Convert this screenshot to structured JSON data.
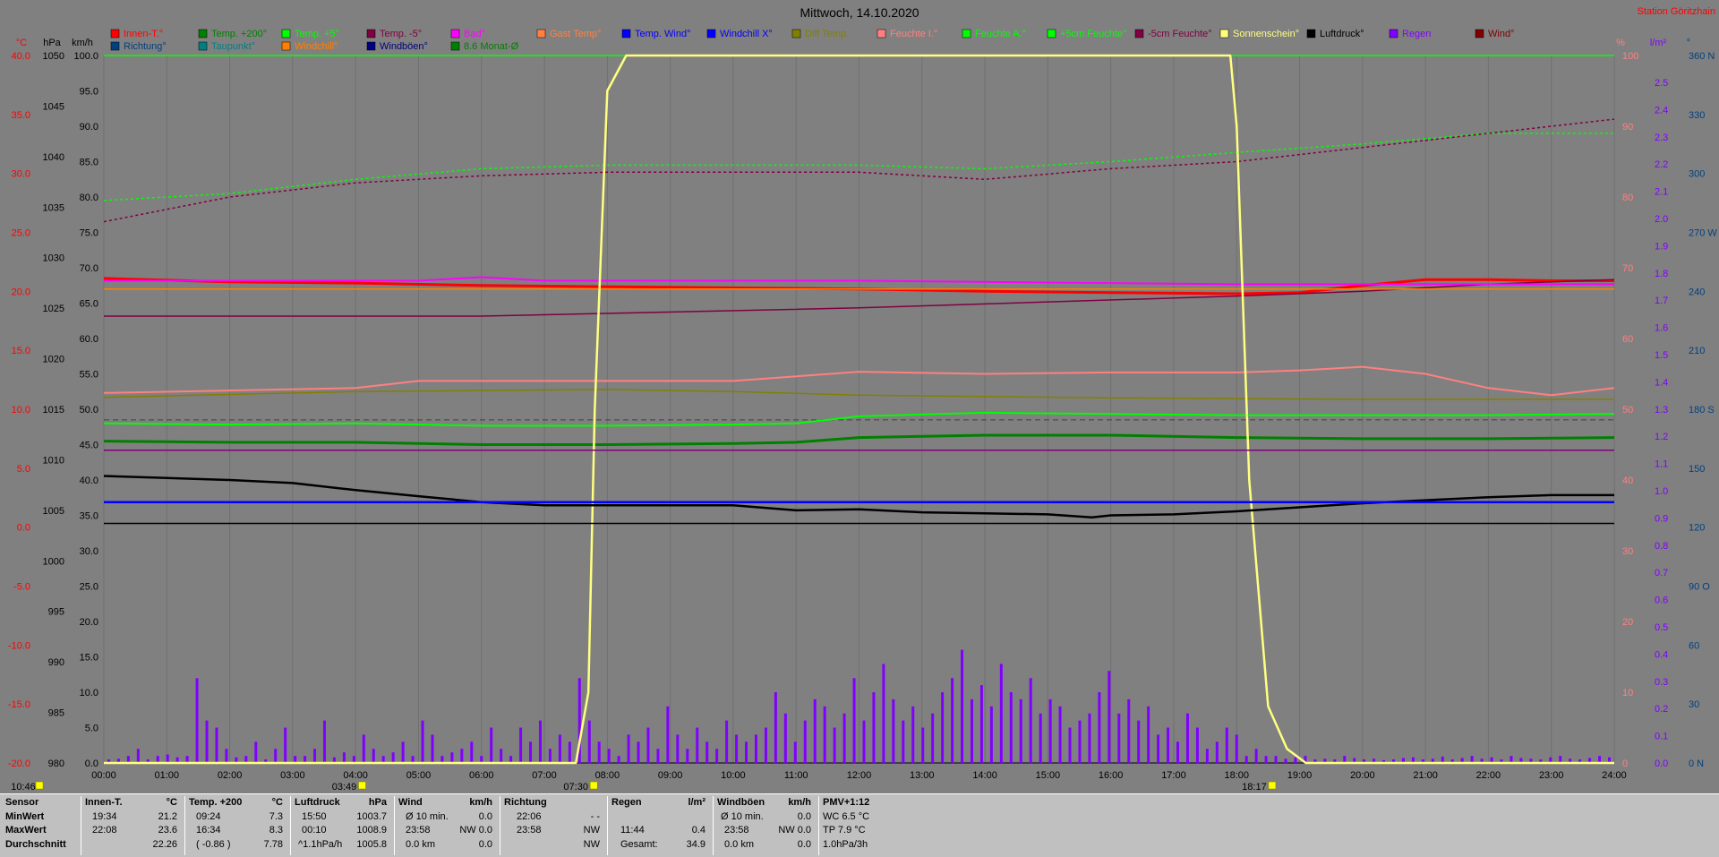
{
  "title": "Mittwoch, 14.10.2020",
  "station": "Station Göritzhain",
  "axes": {
    "tempUnit": "°C",
    "tempTicks": [
      "40.0",
      "35.0",
      "30.0",
      "25.0",
      "20.0",
      "15.0",
      "10.0",
      "5.0",
      "0.0",
      "-5.0",
      "-10.0",
      "-15.0",
      "-20.0"
    ],
    "hpaUnit": "hPa",
    "hpaTicks": [
      "1050",
      "1045",
      "1040",
      "1035",
      "1030",
      "1025",
      "1020",
      "1015",
      "1010",
      "1005",
      "1000",
      "995",
      "990",
      "985",
      "980"
    ],
    "kmhUnit": "km/h",
    "kmhTicks": [
      "100.0",
      "95.0",
      "90.0",
      "85.0",
      "80.0",
      "75.0",
      "70.0",
      "65.0",
      "60.0",
      "55.0",
      "50.0",
      "45.0",
      "40.0",
      "35.0",
      "30.0",
      "25.0",
      "20.0",
      "15.0",
      "10.0",
      "5.0",
      "0.0"
    ],
    "pctUnit": "%",
    "pctTicks": [
      "100",
      "90",
      "80",
      "70",
      "60",
      "50",
      "40",
      "30",
      "20",
      "10",
      "0"
    ],
    "rainUnit": "l/m²",
    "rainTicks": [
      "2.5",
      "2.4",
      "2.3",
      "2.2",
      "2.1",
      "2.0",
      "1.9",
      "1.8",
      "1.7",
      "1.6",
      "1.5",
      "1.4",
      "1.3",
      "1.2",
      "1.1",
      "1.0",
      "0.9",
      "0.8",
      "0.7",
      "0.6",
      "0.5",
      "0.4",
      "0.3",
      "0.2",
      "0.1",
      "0.0"
    ],
    "dirUnit": "°",
    "dirTicks": [
      "360 N",
      "330",
      "300",
      "270 W",
      "240",
      "210",
      "180 S",
      "150",
      "120",
      "90 O",
      "60",
      "30",
      "0 N"
    ],
    "timeTicks": [
      "00:00",
      "01:00",
      "02:00",
      "03:00",
      "04:00",
      "05:00",
      "06:00",
      "07:00",
      "08:00",
      "09:00",
      "10:00",
      "11:00",
      "12:00",
      "13:00",
      "14:00",
      "15:00",
      "16:00",
      "17:00",
      "18:00",
      "19:00",
      "20:00",
      "21:00",
      "22:00",
      "23:00",
      "24:00"
    ],
    "markers": [
      {
        "label": "10:46",
        "hour": 0
      },
      {
        "label": "03:49",
        "hour": 3.82
      },
      {
        "label": "07:30",
        "hour": 7.5
      },
      {
        "label": "18:17",
        "hour": 18.28
      }
    ]
  },
  "legend": {
    "row1": [
      {
        "label": "Innen-T.°",
        "color": "#ff0000"
      },
      {
        "label": "Temp. +200°",
        "color": "#008000"
      },
      {
        "label": "Temp. +5°",
        "color": "#00ff00"
      },
      {
        "label": "Temp. -5°",
        "color": "#800040"
      },
      {
        "label": "Bad°",
        "color": "#ff00ff"
      },
      {
        "label": "Gast Temp°",
        "color": "#ff8040"
      },
      {
        "label": "Temp. Wind°",
        "color": "#0000ff"
      },
      {
        "label": "Windchill X°",
        "color": "#0000ff"
      },
      {
        "label": "Diff Temp.",
        "color": "#808000"
      },
      {
        "label": "Feuchte I.°",
        "color": "#ff8080"
      },
      {
        "label": "Feuchte A.°",
        "color": "#00ff00"
      },
      {
        "label": "+5cm Feuchte°",
        "color": "#00ff00"
      },
      {
        "label": "-5cm Feuchte°",
        "color": "#800040"
      },
      {
        "label": "Sonnenschein°",
        "color": "#ffff80"
      },
      {
        "label": "Luftdruck°",
        "color": "#000000"
      },
      {
        "label": "Regen",
        "color": "#8000ff"
      },
      {
        "label": "Wind°",
        "color": "#800000"
      }
    ],
    "row2": [
      {
        "label": "Richtung°",
        "color": "#004080"
      },
      {
        "label": "Taupunkt°",
        "color": "#008080"
      },
      {
        "label": "Windchill°",
        "color": "#ff8000"
      },
      {
        "label": "Windböen°",
        "color": "#000080"
      },
      {
        "label": "8.6 Monat-Ø",
        "color": "#008000"
      }
    ]
  },
  "chart_data": {
    "type": "line",
    "title": "Mittwoch, 14.10.2020",
    "x_range": [
      0,
      24
    ],
    "series": [
      {
        "name": "Innen-T.°",
        "axis": "temp",
        "color": "#ff0000",
        "width": 3,
        "x": [
          0,
          2,
          4,
          6,
          8,
          10,
          12,
          14,
          16,
          18,
          19,
          20,
          21,
          22,
          23,
          24
        ],
        "y": [
          21.1,
          20.8,
          20.7,
          20.5,
          20.4,
          20.3,
          20.2,
          20.0,
          19.9,
          19.8,
          19.9,
          20.5,
          21.0,
          21.0,
          20.9,
          20.9
        ]
      },
      {
        "name": "Temp. +200°",
        "axis": "temp",
        "color": "#008000",
        "width": 3,
        "x": [
          0,
          2,
          4,
          6,
          8,
          10,
          11,
          12,
          14,
          16,
          18,
          20,
          22,
          24
        ],
        "y": [
          7.3,
          7.2,
          7.2,
          7.0,
          7.0,
          7.1,
          7.2,
          7.6,
          7.8,
          7.8,
          7.6,
          7.5,
          7.5,
          7.6
        ]
      },
      {
        "name": "Temp. +5°",
        "axis": "temp",
        "color": "#00ff00",
        "width": 2,
        "x": [
          0,
          2,
          4,
          6,
          8,
          10,
          11,
          12,
          14,
          16,
          18,
          20,
          22,
          24
        ],
        "y": [
          8.8,
          8.7,
          8.8,
          8.6,
          8.6,
          8.7,
          8.8,
          9.4,
          9.7,
          9.6,
          9.5,
          9.5,
          9.5,
          9.6
        ]
      },
      {
        "name": "Temp. -5°",
        "axis": "temp",
        "color": "#800040",
        "width": 1.5,
        "x": [
          0,
          6,
          12,
          18,
          20,
          22,
          24
        ],
        "y": [
          17.9,
          17.9,
          18.6,
          19.6,
          20.0,
          20.6,
          21.0
        ]
      },
      {
        "name": "Bad°",
        "axis": "temp",
        "color": "#ff00ff",
        "width": 2,
        "x": [
          0,
          5,
          6,
          7,
          12,
          18,
          24
        ],
        "y": [
          20.9,
          20.9,
          21.2,
          20.9,
          20.9,
          20.6,
          20.6
        ]
      },
      {
        "name": "Windchill°",
        "axis": "temp",
        "color": "#ff8000",
        "width": 1.5,
        "x": [
          0,
          24
        ],
        "y": [
          20.2,
          20.2
        ]
      },
      {
        "name": "Feuchte I.°",
        "axis": "pct",
        "color": "#ff8080",
        "width": 2,
        "x": [
          0,
          4,
          5,
          10,
          12,
          14,
          16,
          18,
          19,
          20,
          21,
          22,
          23,
          24
        ],
        "y": [
          52.3,
          53.0,
          54.0,
          54.0,
          55.3,
          55.0,
          55.2,
          55.2,
          55.5,
          56.0,
          55.0,
          53.0,
          52.0,
          53.0
        ]
      },
      {
        "name": "Diff Temp.",
        "axis": "pct",
        "color": "#808000",
        "width": 1.5,
        "x": [
          0,
          4,
          8,
          10,
          12,
          16,
          20,
          24
        ],
        "y": [
          51.7,
          52.5,
          52.8,
          52.5,
          52.0,
          51.6,
          51.4,
          51.4
        ]
      },
      {
        "name": "Feuchte A.°",
        "axis": "pct",
        "color": "#00ff00",
        "width": 1.5,
        "x": [
          0,
          24
        ],
        "y": [
          100,
          100
        ]
      },
      {
        "name": "+5cm Feuchte°",
        "axis": "pct",
        "color": "#00ff00",
        "width": 1.5,
        "dash": "3,3",
        "x": [
          0,
          2,
          4,
          6,
          8,
          10,
          12,
          14,
          16,
          18,
          20,
          22,
          24
        ],
        "y": [
          79.5,
          80.5,
          82.5,
          84.0,
          84.5,
          84.5,
          84.5,
          84.0,
          85.0,
          86.3,
          87.5,
          89.0,
          89.0
        ]
      },
      {
        "name": "-5cm Feuchte°",
        "axis": "pct",
        "color": "#800040",
        "width": 1.5,
        "dash": "3,3",
        "x": [
          0,
          2,
          4,
          6,
          8,
          10,
          12,
          14,
          16,
          18,
          20,
          22,
          24
        ],
        "y": [
          76.5,
          80.0,
          82.0,
          83.0,
          83.5,
          83.5,
          83.5,
          82.5,
          84.0,
          85.0,
          87.0,
          89.0,
          91.0
        ]
      },
      {
        "name": "Sonnenschein°",
        "axis": "pct",
        "color": "#ffff80",
        "width": 2.5,
        "x": [
          0,
          7.5,
          7.7,
          7.8,
          8.0,
          8.3,
          17.9,
          18.0,
          18.2,
          18.5,
          18.8,
          19.1,
          24
        ],
        "y": [
          0,
          0,
          10,
          50,
          95,
          100,
          100,
          90,
          40,
          8,
          2,
          0,
          0
        ]
      },
      {
        "name": "Luftdruck°",
        "axis": "hpa",
        "color": "#000000",
        "width": 2.5,
        "x": [
          0,
          1,
          2,
          3,
          4,
          5,
          6,
          7,
          8,
          9,
          10,
          11,
          12,
          13,
          14,
          15,
          15.7,
          16,
          17,
          18,
          19,
          20,
          21,
          22,
          23,
          24
        ],
        "y": [
          1008.4,
          1008.2,
          1008.0,
          1007.7,
          1007.0,
          1006.4,
          1005.8,
          1005.5,
          1005.5,
          1005.5,
          1005.5,
          1005.0,
          1005.1,
          1004.8,
          1004.7,
          1004.6,
          1004.3,
          1004.5,
          1004.6,
          1004.9,
          1005.3,
          1005.7,
          1006.0,
          1006.3,
          1006.5,
          1006.5
        ]
      },
      {
        "name": "Temp. Wind°",
        "axis": "hpa",
        "color": "#0000ff",
        "width": 2.5,
        "x": [
          0,
          24
        ],
        "y": [
          1005.8,
          1005.8
        ]
      },
      {
        "name": "Windböen°",
        "axis": "hpa",
        "color": "#000000",
        "width": 1.5,
        "x": [
          0,
          24
        ],
        "y": [
          1003.7,
          1003.7
        ]
      },
      {
        "name": "Windchill X°",
        "axis": "pct",
        "color": "#800080",
        "width": 1.5,
        "x": [
          0,
          24
        ],
        "y": [
          44.2,
          44.2
        ]
      }
    ],
    "rain_bars": {
      "axis": "kmh",
      "color": "#8000ff",
      "note": "wind bars (km/h), one per ~10 min",
      "values": [
        0.5,
        0.6,
        1,
        2,
        0.5,
        1,
        1.2,
        0.8,
        1,
        12,
        6,
        5,
        2,
        0.8,
        1,
        3,
        0.5,
        2,
        5,
        1,
        1,
        2,
        6,
        0.8,
        1.5,
        1,
        4,
        2,
        1,
        1.5,
        3,
        1,
        6,
        4,
        1,
        1.5,
        2,
        3,
        1,
        5,
        2,
        1,
        5,
        3,
        6,
        2,
        4,
        3,
        12,
        6,
        3,
        2,
        1,
        4,
        3,
        5,
        2,
        8,
        4,
        2,
        5,
        3,
        2,
        6,
        4,
        3,
        4,
        5,
        10,
        7,
        3,
        6,
        9,
        8,
        5,
        7,
        12,
        6,
        10,
        14,
        9,
        6,
        8,
        5,
        7,
        10,
        12,
        16,
        9,
        11,
        8,
        14,
        10,
        9,
        12,
        7,
        9,
        8,
        5,
        6,
        7,
        10,
        13,
        7,
        9,
        6,
        8,
        4,
        5,
        3,
        7,
        5,
        2,
        3,
        5,
        4,
        1,
        2,
        1,
        1,
        0.6,
        0.8,
        1,
        0.5,
        0.6,
        0.5,
        1,
        0.7,
        0.5,
        0.6,
        0.4,
        0.5,
        0.7,
        0.8,
        0.5,
        0.6,
        0.9,
        0.5,
        0.7,
        1,
        0.6,
        0.8,
        0.5,
        1,
        0.7,
        0.6,
        0.5,
        0.8,
        1,
        0.6,
        0.5,
        0.7,
        1,
        0.8
      ]
    }
  },
  "stats": {
    "sensor": {
      "title": "Sensor",
      "rows": [
        "MinWert",
        "MaxWert",
        "Durchschnitt"
      ]
    },
    "innen": {
      "title": "Innen-T.",
      "unit": "°C",
      "rows": [
        [
          "19:34",
          "21.2"
        ],
        [
          "22:08",
          "23.6"
        ],
        [
          "",
          "22.26"
        ]
      ]
    },
    "temp200": {
      "title": "Temp. +200",
      "unit": "°C",
      "rows": [
        [
          "09:24",
          "7.3"
        ],
        [
          "16:34",
          "8.3"
        ],
        [
          "( -0.86 )",
          "7.78"
        ]
      ]
    },
    "luftdruck": {
      "title": "Luftdruck",
      "unit": "hPa",
      "rows": [
        [
          "15:50",
          "1003.7"
        ],
        [
          "00:10",
          "1008.9"
        ],
        [
          "^1.1hPa/h",
          "1005.8"
        ]
      ]
    },
    "wind": {
      "title": "Wind",
      "unit": "km/h",
      "rows": [
        [
          "Ø 10 min.",
          "0.0"
        ],
        [
          "23:58",
          "NW 0.0"
        ],
        [
          "0.0 km",
          "0.0"
        ]
      ]
    },
    "richtung": {
      "title": "Richtung",
      "rows": [
        [
          "22:06",
          "- -"
        ],
        [
          "23:58",
          "NW"
        ],
        [
          "",
          "NW"
        ]
      ]
    },
    "regen": {
      "title": "Regen",
      "unit": "l/m²",
      "rows": [
        [
          "",
          ""
        ],
        [
          "11:44",
          "0.4"
        ],
        [
          "Gesamt:",
          "34.9"
        ]
      ]
    },
    "windboen": {
      "title": "Windböen",
      "unit": "km/h",
      "rows": [
        [
          "Ø 10 min.",
          "0.0"
        ],
        [
          "23:58",
          "NW 0.0"
        ],
        [
          "0.0 km",
          "0.0"
        ]
      ]
    },
    "pmv": {
      "title": "PMV+1:12",
      "rows": [
        "WC 6.5 °C",
        "TP 7.9 °C",
        "1.0hPa/3h"
      ]
    }
  }
}
